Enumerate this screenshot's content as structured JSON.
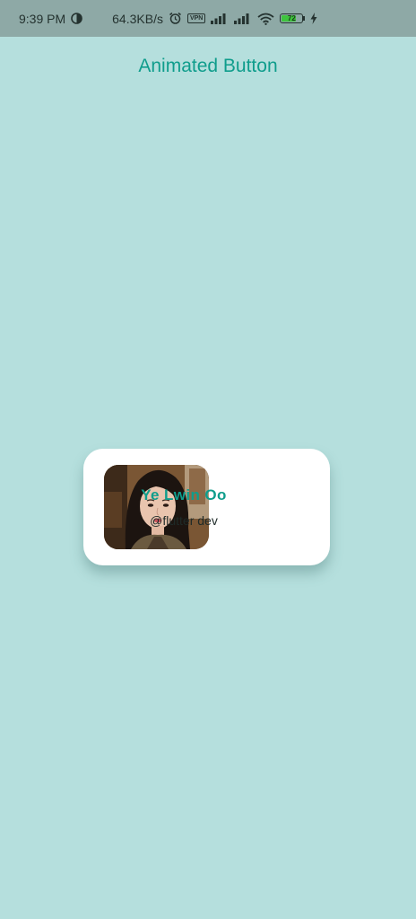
{
  "status_bar": {
    "time": "9:39 PM",
    "network_speed": "64.3KB/s",
    "vpn_label": "VPN",
    "battery_level": "72",
    "icons": [
      "data-saver-icon",
      "alarm-icon",
      "vpn-icon",
      "signal-icon",
      "signal-icon",
      "wifi-icon",
      "battery-icon",
      "charging-icon"
    ]
  },
  "app_bar": {
    "title": "Animated Button"
  },
  "profile_card": {
    "name": "Ye Lwin Oo",
    "handle": "@flutter dev"
  },
  "colors": {
    "background": "#b5dfdd",
    "status_bar": "#8ea9a6",
    "accent": "#0f9d8c",
    "card": "#ffffff",
    "battery_fill": "#3ec43e"
  }
}
